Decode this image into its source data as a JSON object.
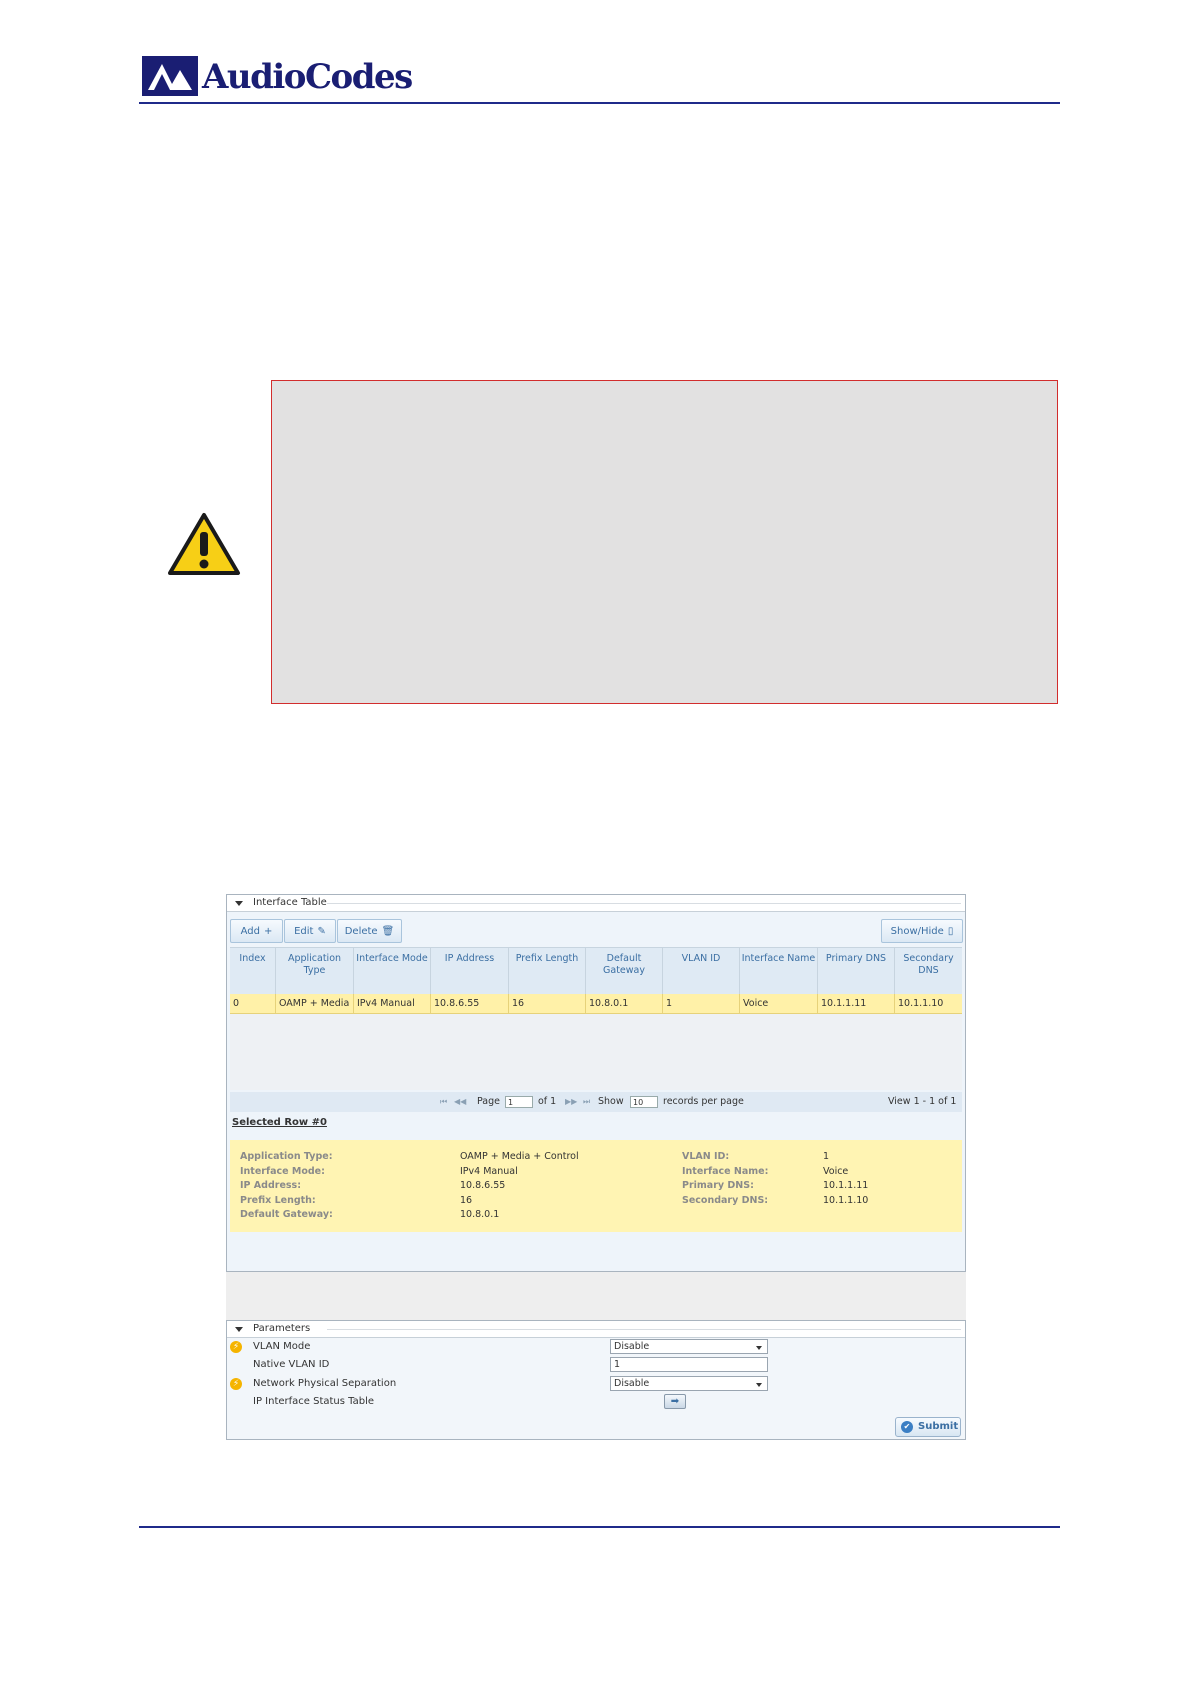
{
  "header": {
    "brand": "AudioCodes"
  },
  "interface_table": {
    "title": "Interface Table",
    "toolbar": {
      "add": "Add",
      "edit": "Edit",
      "delete": "Delete",
      "show_hide": "Show/Hide"
    },
    "columns": [
      "Index",
      "Application Type",
      "Interface Mode",
      "IP Address",
      "Prefix Length",
      "Default Gateway",
      "VLAN ID",
      "Interface Name",
      "Primary DNS",
      "Secondary DNS"
    ],
    "rows": [
      [
        "0",
        "OAMP + Media",
        "IPv4 Manual",
        "10.8.6.55",
        "16",
        "10.8.0.1",
        "1",
        "Voice",
        "10.1.1.11",
        "10.1.1.10"
      ]
    ],
    "pager": {
      "page_label": "Page",
      "page_value": "1",
      "of_label": "of 1",
      "show_label": "Show",
      "show_value": "10",
      "records_label": "records per page",
      "view_label": "View 1 - 1 of 1"
    },
    "selected_row_label": "Selected Row #0",
    "details_left": [
      {
        "label": "Application Type:",
        "value": "OAMP + Media + Control"
      },
      {
        "label": "Interface Mode:",
        "value": "IPv4 Manual"
      },
      {
        "label": "IP Address:",
        "value": "10.8.6.55"
      },
      {
        "label": "Prefix Length:",
        "value": "16"
      },
      {
        "label": "Default Gateway:",
        "value": "10.8.0.1"
      }
    ],
    "details_right": [
      {
        "label": "VLAN ID:",
        "value": "1"
      },
      {
        "label": "Interface Name:",
        "value": "Voice"
      },
      {
        "label": "Primary DNS:",
        "value": "10.1.1.11"
      },
      {
        "label": "Secondary DNS:",
        "value": "10.1.1.10"
      }
    ]
  },
  "parameters": {
    "title": "Parameters",
    "vlan_mode": {
      "label": "VLAN Mode",
      "value": "Disable"
    },
    "native_vlan_id": {
      "label": "Native VLAN ID",
      "value": "1"
    },
    "network_physical_separation": {
      "label": "Network Physical Separation",
      "value": "Disable"
    },
    "ip_interface_status_table": {
      "label": "IP Interface Status Table"
    },
    "submit": "Submit"
  }
}
